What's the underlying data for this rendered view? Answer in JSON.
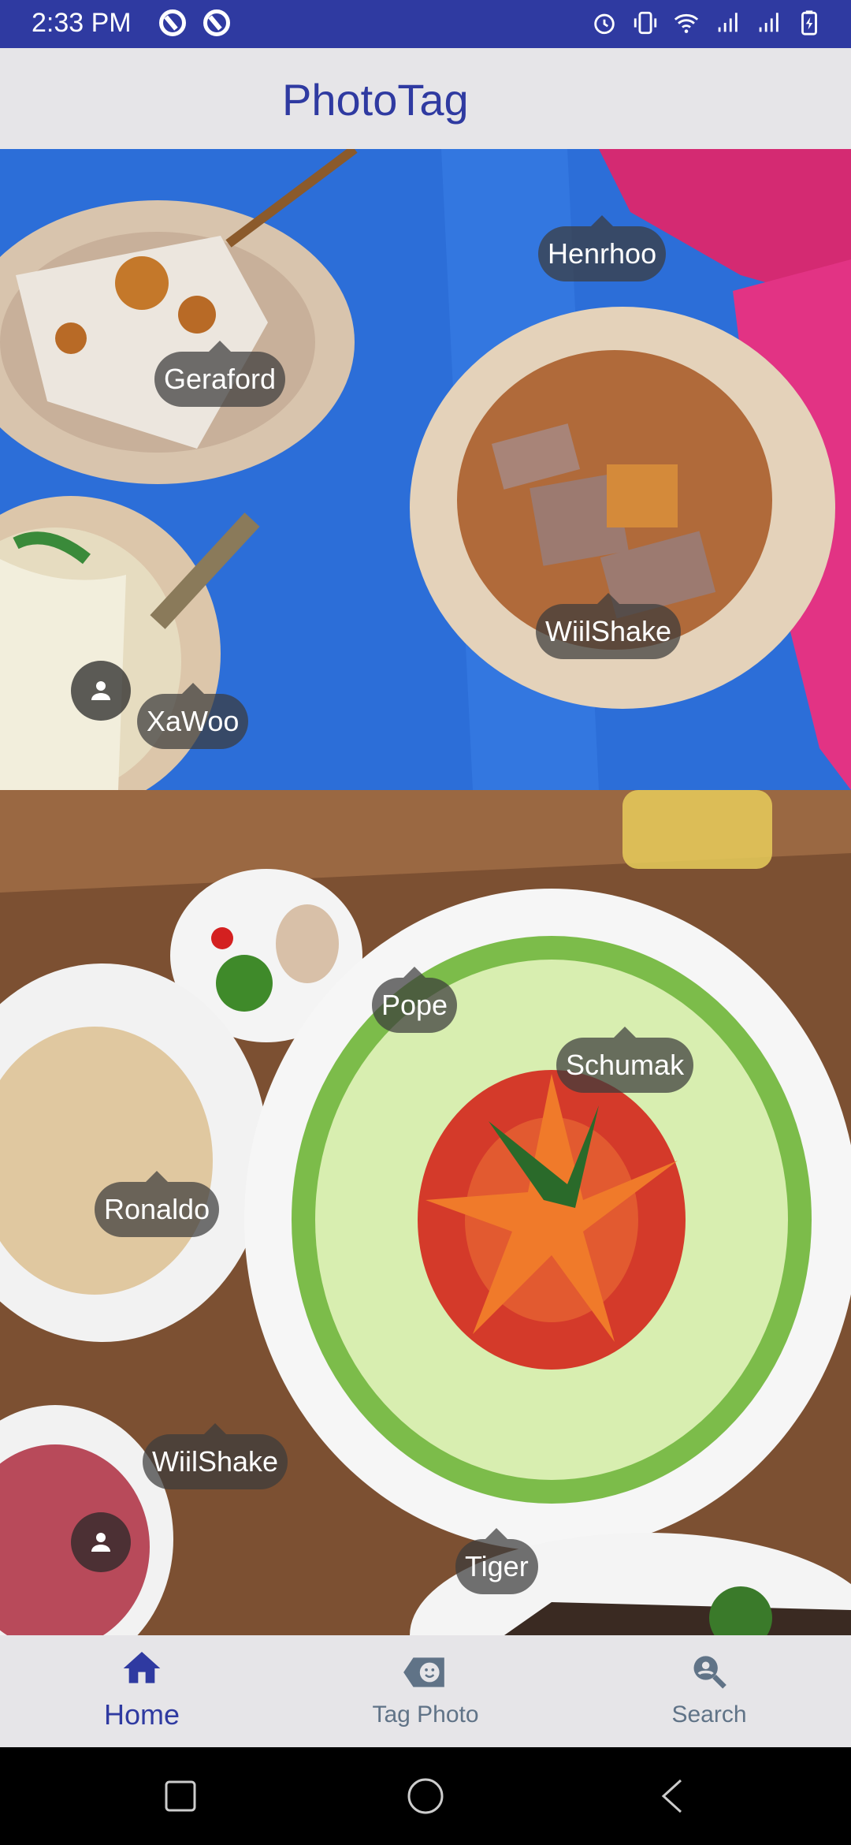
{
  "status_bar": {
    "time": "2:33 PM",
    "left_icons": [
      "do-not-disturb-icon",
      "do-not-disturb-icon"
    ],
    "right_icons": [
      "alarm-icon",
      "vibrate-icon",
      "wifi-icon",
      "signal-icon",
      "signal-icon",
      "battery-icon"
    ]
  },
  "app_bar": {
    "title": "PhotoTag"
  },
  "photos": [
    {
      "tags": [
        "Henrhoo",
        "Geraford",
        "WiilShake",
        "XaWoo"
      ]
    },
    {
      "tags": [
        "Pope",
        "Schumak",
        "Ronaldo",
        "WiilShake",
        "Tiger"
      ]
    }
  ],
  "bottom_nav": {
    "items": [
      {
        "label": "Home",
        "icon": "home-icon",
        "active": true
      },
      {
        "label": "Tag Photo",
        "icon": "tag-face-icon",
        "active": false
      },
      {
        "label": "Search",
        "icon": "person-search-icon",
        "active": false
      }
    ]
  },
  "colors": {
    "primary": "#2f3aa1",
    "nav_inactive": "#607387",
    "background": "#e6e5e8"
  }
}
